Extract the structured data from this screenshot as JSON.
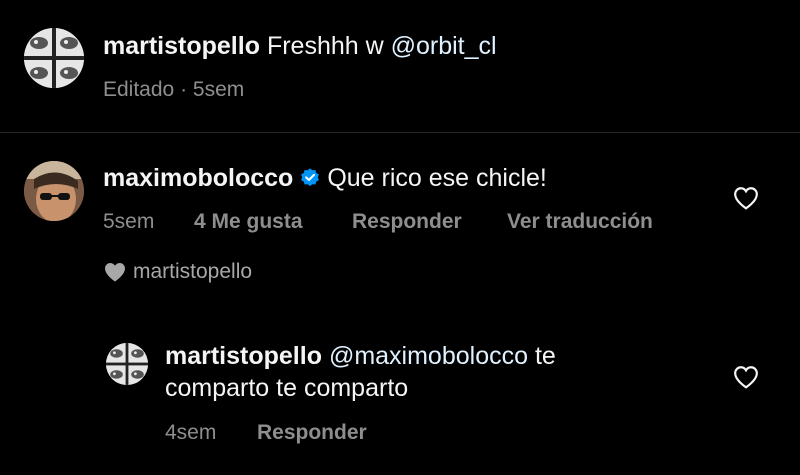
{
  "caption": {
    "username": "martistopello",
    "text": "Freshhh w ",
    "mention": "@orbit_cl",
    "edited_label": "Editado",
    "separator": "·",
    "time": "5sem"
  },
  "comment": {
    "username": "maximobolocco",
    "verified": true,
    "text": "Que rico ese chicle!",
    "time": "5sem",
    "likes": "4 Me gusta",
    "reply_label": "Responder",
    "translate_label": "Ver traducción",
    "liked_by": "martistopello"
  },
  "reply": {
    "username": "martistopello",
    "mention": "@maximobolocco",
    "text_line1_rest": " te",
    "text_line2": "comparto te comparto",
    "time": "4sem",
    "reply_label": "Responder"
  },
  "colors": {
    "background": "#000000",
    "text": "#f5f5f5",
    "meta": "#8e8e8e",
    "verified": "#0095f6",
    "mention": "#e0f1ff"
  },
  "icons": {
    "verified": "verified-badge-icon",
    "like": "heart-outline-icon",
    "liked_by": "heart-filled-icon"
  }
}
